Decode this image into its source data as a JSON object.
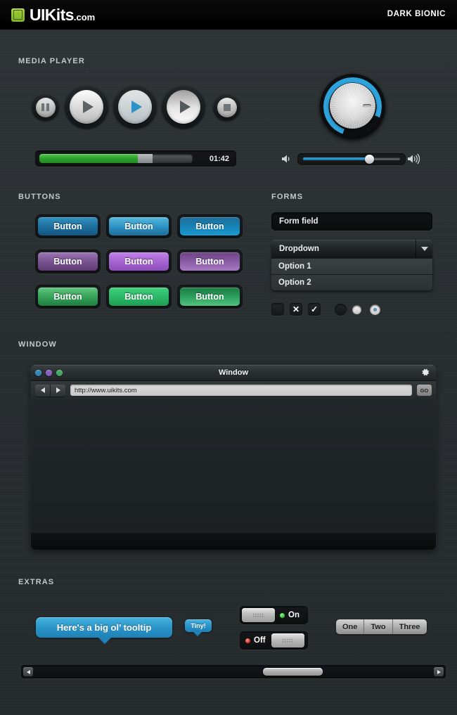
{
  "header": {
    "logo_text": "UIKits",
    "logo_suffix": ".com",
    "logo_icon": "uikits-logo-icon",
    "kit_name": "DARK BIONIC"
  },
  "sections": {
    "media_player": "MEDIA PLAYER",
    "buttons": "BUTTONS",
    "forms": "FORMS",
    "window": "WINDOW",
    "extras": "EXTRAS"
  },
  "media_player": {
    "controls": [
      {
        "name": "pause-button",
        "icon": "pause-icon",
        "size": 36,
        "face": "grey",
        "accent": "#6e7477"
      },
      {
        "name": "play-button-large",
        "icon": "play-icon",
        "size": 62,
        "face": "light",
        "accent": "#5d6265"
      },
      {
        "name": "play-button-active",
        "icon": "play-icon",
        "size": 62,
        "face": "blue",
        "accent": "#2a93c8"
      },
      {
        "name": "play-button-hover",
        "icon": "play-icon",
        "size": 62,
        "face": "light",
        "accent": "#555a5d"
      },
      {
        "name": "stop-button",
        "icon": "stop-icon",
        "size": 36,
        "face": "grey",
        "accent": "#6e7477"
      }
    ],
    "progress": {
      "played_percent": 64,
      "buffered_percent": 74,
      "time": "01:42",
      "fill_color": "#2ea12c"
    },
    "knob": {
      "name": "volume-knob",
      "arc_color": "#2ea3dd",
      "value_percent": 75
    },
    "volume": {
      "low_icon": "speaker-low-icon",
      "high_icon": "speaker-high-icon",
      "value_percent": 68,
      "fill_color": "#2f8fc4"
    }
  },
  "buttons": {
    "label": "Button",
    "rows": [
      {
        "name": "blue-buttons",
        "items": [
          {
            "top": "#2e93c1",
            "mid": "#1f6f9e",
            "bot": "#13557f"
          },
          {
            "top": "#56b9dd",
            "mid": "#2f93c4",
            "bot": "#1d6d99"
          },
          {
            "top": "#1d6f9c",
            "mid": "#1782b4",
            "bot": "#1a9ad0"
          }
        ]
      },
      {
        "name": "purple-buttons",
        "items": [
          {
            "top": "#9a76b4",
            "mid": "#7a5391",
            "bot": "#5e3a72"
          },
          {
            "top": "#c182ea",
            "mid": "#a663d2",
            "bot": "#8d4fbb"
          },
          {
            "top": "#6c4385",
            "mid": "#8b5ca6",
            "bot": "#a877c2"
          }
        ]
      },
      {
        "name": "green-buttons",
        "items": [
          {
            "top": "#63c77f",
            "mid": "#36a25a",
            "bot": "#1f7d41"
          },
          {
            "top": "#3fd17e",
            "mid": "#2cb868",
            "bot": "#1d9e53"
          },
          {
            "top": "#1d7a43",
            "mid": "#2ba05c",
            "bot": "#56c17f"
          }
        ]
      }
    ]
  },
  "forms": {
    "form_field": {
      "name": "form-field-input",
      "value": "Form field"
    },
    "dropdown": {
      "name": "dropdown-select",
      "value": "Dropdown",
      "arrow_icon": "chevron-down-icon",
      "options": [
        "Option 1",
        "Option 2"
      ]
    },
    "checkboxes": [
      {
        "name": "checkbox-empty",
        "glyph": ""
      },
      {
        "name": "checkbox-cross",
        "glyph": "✕"
      },
      {
        "name": "checkbox-check",
        "glyph": "✓"
      }
    ],
    "radios": [
      {
        "name": "radio-empty",
        "state": "empty"
      },
      {
        "name": "radio-filled",
        "state": "filled"
      },
      {
        "name": "radio-selected",
        "state": "selected"
      }
    ]
  },
  "window": {
    "title": "Window",
    "dots": [
      {
        "name": "window-dot-blue",
        "color": "#2e8ab5"
      },
      {
        "name": "window-dot-purple",
        "color": "#8b5cc4"
      },
      {
        "name": "window-dot-green",
        "color": "#3faa5d"
      }
    ],
    "gear_icon": "gear-icon",
    "back_icon": "back-arrow-icon",
    "forward_icon": "forward-arrow-icon",
    "url": "http://www.uikits.com",
    "go_label": "GO"
  },
  "extras": {
    "tooltip_big": {
      "name": "tooltip-large",
      "text": "Here's a big ol’ tooltip"
    },
    "tooltip_small": {
      "name": "tooltip-small",
      "text": "Tiny!"
    },
    "toggles": [
      {
        "name": "toggle-on",
        "label": "On",
        "state": "on",
        "led_color": "#3ecb3e"
      },
      {
        "name": "toggle-off",
        "label": "Off",
        "state": "off",
        "led_color": "#e03a30"
      }
    ],
    "segmented": {
      "name": "segmented-control",
      "items": [
        "One",
        "Two",
        "Three"
      ]
    },
    "scrollbar": {
      "name": "horizontal-scrollbar",
      "left_icon": "scroll-left-icon",
      "right_icon": "scroll-right-icon",
      "thumb_position_percent": 65,
      "thumb_width_percent": 15
    }
  }
}
